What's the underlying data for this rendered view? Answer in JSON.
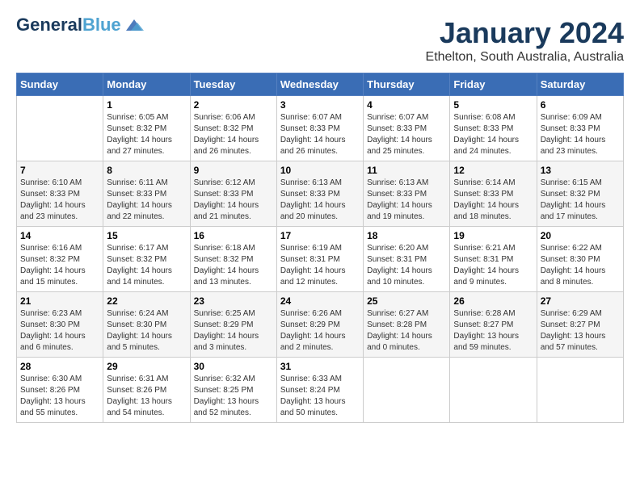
{
  "logo": {
    "general": "General",
    "blue": "Blue"
  },
  "title": "January 2024",
  "subtitle": "Ethelton, South Australia, Australia",
  "headers": [
    "Sunday",
    "Monday",
    "Tuesday",
    "Wednesday",
    "Thursday",
    "Friday",
    "Saturday"
  ],
  "weeks": [
    [
      {
        "day": "",
        "info": ""
      },
      {
        "day": "1",
        "info": "Sunrise: 6:05 AM\nSunset: 8:32 PM\nDaylight: 14 hours\nand 27 minutes."
      },
      {
        "day": "2",
        "info": "Sunrise: 6:06 AM\nSunset: 8:32 PM\nDaylight: 14 hours\nand 26 minutes."
      },
      {
        "day": "3",
        "info": "Sunrise: 6:07 AM\nSunset: 8:33 PM\nDaylight: 14 hours\nand 26 minutes."
      },
      {
        "day": "4",
        "info": "Sunrise: 6:07 AM\nSunset: 8:33 PM\nDaylight: 14 hours\nand 25 minutes."
      },
      {
        "day": "5",
        "info": "Sunrise: 6:08 AM\nSunset: 8:33 PM\nDaylight: 14 hours\nand 24 minutes."
      },
      {
        "day": "6",
        "info": "Sunrise: 6:09 AM\nSunset: 8:33 PM\nDaylight: 14 hours\nand 23 minutes."
      }
    ],
    [
      {
        "day": "7",
        "info": "Sunrise: 6:10 AM\nSunset: 8:33 PM\nDaylight: 14 hours\nand 23 minutes."
      },
      {
        "day": "8",
        "info": "Sunrise: 6:11 AM\nSunset: 8:33 PM\nDaylight: 14 hours\nand 22 minutes."
      },
      {
        "day": "9",
        "info": "Sunrise: 6:12 AM\nSunset: 8:33 PM\nDaylight: 14 hours\nand 21 minutes."
      },
      {
        "day": "10",
        "info": "Sunrise: 6:13 AM\nSunset: 8:33 PM\nDaylight: 14 hours\nand 20 minutes."
      },
      {
        "day": "11",
        "info": "Sunrise: 6:13 AM\nSunset: 8:33 PM\nDaylight: 14 hours\nand 19 minutes."
      },
      {
        "day": "12",
        "info": "Sunrise: 6:14 AM\nSunset: 8:33 PM\nDaylight: 14 hours\nand 18 minutes."
      },
      {
        "day": "13",
        "info": "Sunrise: 6:15 AM\nSunset: 8:32 PM\nDaylight: 14 hours\nand 17 minutes."
      }
    ],
    [
      {
        "day": "14",
        "info": "Sunrise: 6:16 AM\nSunset: 8:32 PM\nDaylight: 14 hours\nand 15 minutes."
      },
      {
        "day": "15",
        "info": "Sunrise: 6:17 AM\nSunset: 8:32 PM\nDaylight: 14 hours\nand 14 minutes."
      },
      {
        "day": "16",
        "info": "Sunrise: 6:18 AM\nSunset: 8:32 PM\nDaylight: 14 hours\nand 13 minutes."
      },
      {
        "day": "17",
        "info": "Sunrise: 6:19 AM\nSunset: 8:31 PM\nDaylight: 14 hours\nand 12 minutes."
      },
      {
        "day": "18",
        "info": "Sunrise: 6:20 AM\nSunset: 8:31 PM\nDaylight: 14 hours\nand 10 minutes."
      },
      {
        "day": "19",
        "info": "Sunrise: 6:21 AM\nSunset: 8:31 PM\nDaylight: 14 hours\nand 9 minutes."
      },
      {
        "day": "20",
        "info": "Sunrise: 6:22 AM\nSunset: 8:30 PM\nDaylight: 14 hours\nand 8 minutes."
      }
    ],
    [
      {
        "day": "21",
        "info": "Sunrise: 6:23 AM\nSunset: 8:30 PM\nDaylight: 14 hours\nand 6 minutes."
      },
      {
        "day": "22",
        "info": "Sunrise: 6:24 AM\nSunset: 8:30 PM\nDaylight: 14 hours\nand 5 minutes."
      },
      {
        "day": "23",
        "info": "Sunrise: 6:25 AM\nSunset: 8:29 PM\nDaylight: 14 hours\nand 3 minutes."
      },
      {
        "day": "24",
        "info": "Sunrise: 6:26 AM\nSunset: 8:29 PM\nDaylight: 14 hours\nand 2 minutes."
      },
      {
        "day": "25",
        "info": "Sunrise: 6:27 AM\nSunset: 8:28 PM\nDaylight: 14 hours\nand 0 minutes."
      },
      {
        "day": "26",
        "info": "Sunrise: 6:28 AM\nSunset: 8:27 PM\nDaylight: 13 hours\nand 59 minutes."
      },
      {
        "day": "27",
        "info": "Sunrise: 6:29 AM\nSunset: 8:27 PM\nDaylight: 13 hours\nand 57 minutes."
      }
    ],
    [
      {
        "day": "28",
        "info": "Sunrise: 6:30 AM\nSunset: 8:26 PM\nDaylight: 13 hours\nand 55 minutes."
      },
      {
        "day": "29",
        "info": "Sunrise: 6:31 AM\nSunset: 8:26 PM\nDaylight: 13 hours\nand 54 minutes."
      },
      {
        "day": "30",
        "info": "Sunrise: 6:32 AM\nSunset: 8:25 PM\nDaylight: 13 hours\nand 52 minutes."
      },
      {
        "day": "31",
        "info": "Sunrise: 6:33 AM\nSunset: 8:24 PM\nDaylight: 13 hours\nand 50 minutes."
      },
      {
        "day": "",
        "info": ""
      },
      {
        "day": "",
        "info": ""
      },
      {
        "day": "",
        "info": ""
      }
    ]
  ]
}
